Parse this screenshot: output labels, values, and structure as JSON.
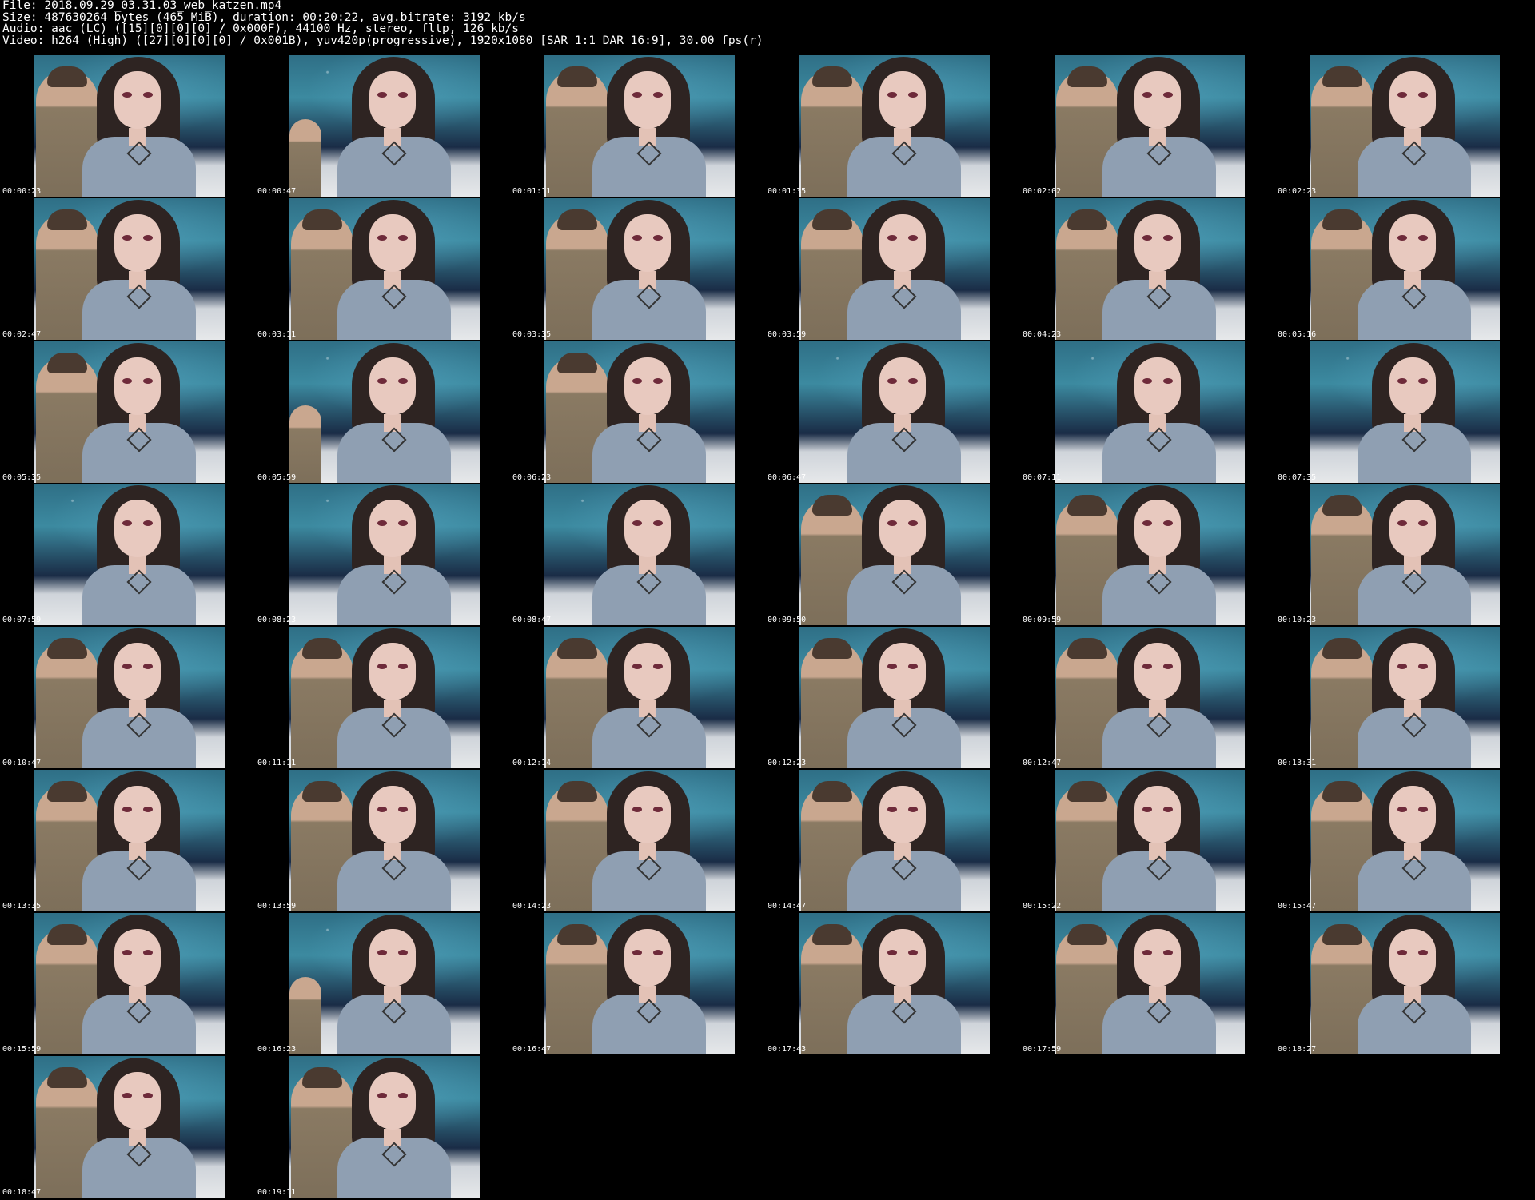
{
  "header": {
    "file": "File: 2018.09.29_03.31.03_web_katzen.mp4",
    "size": "Size: 487630264 bytes (465 MiB), duration: 00:20:22, avg.bitrate: 3192 kb/s",
    "audio": "Audio: aac (LC) ([15][0][0][0] / 0x000F), 44100 Hz, stereo, fltp, 126 kb/s",
    "video": "Video: h264 (High) ([27][0][0][0] / 0x001B), yuv420p(progressive), 1920x1080 [SAR 1:1 DAR 16:9], 30.00 fps(r)"
  },
  "thumbnails": [
    {
      "time": "00:00:23",
      "variant": "duo"
    },
    {
      "time": "00:00:47",
      "variant": "left-arm"
    },
    {
      "time": "00:01:11",
      "variant": "duo"
    },
    {
      "time": "00:01:35",
      "variant": "duo"
    },
    {
      "time": "00:02:02",
      "variant": "duo"
    },
    {
      "time": "00:02:23",
      "variant": "duo"
    },
    {
      "time": "00:02:47",
      "variant": "duo"
    },
    {
      "time": "00:03:11",
      "variant": "duo"
    },
    {
      "time": "00:03:35",
      "variant": "duo"
    },
    {
      "time": "00:03:59",
      "variant": "duo"
    },
    {
      "time": "00:04:23",
      "variant": "duo"
    },
    {
      "time": "00:05:16",
      "variant": "duo"
    },
    {
      "time": "00:05:35",
      "variant": "duo"
    },
    {
      "time": "00:05:59",
      "variant": "left-arm"
    },
    {
      "time": "00:06:23",
      "variant": "duo"
    },
    {
      "time": "00:06:47",
      "variant": "solo"
    },
    {
      "time": "00:07:11",
      "variant": "solo"
    },
    {
      "time": "00:07:35",
      "variant": "solo"
    },
    {
      "time": "00:07:59",
      "variant": "solo"
    },
    {
      "time": "00:08:23",
      "variant": "solo"
    },
    {
      "time": "00:08:47",
      "variant": "solo"
    },
    {
      "time": "00:09:50",
      "variant": "duo"
    },
    {
      "time": "00:09:59",
      "variant": "duo"
    },
    {
      "time": "00:10:23",
      "variant": "duo"
    },
    {
      "time": "00:10:47",
      "variant": "duo"
    },
    {
      "time": "00:11:11",
      "variant": "duo"
    },
    {
      "time": "00:12:14",
      "variant": "duo"
    },
    {
      "time": "00:12:23",
      "variant": "duo"
    },
    {
      "time": "00:12:47",
      "variant": "duo"
    },
    {
      "time": "00:13:31",
      "variant": "duo"
    },
    {
      "time": "00:13:35",
      "variant": "duo"
    },
    {
      "time": "00:13:59",
      "variant": "duo"
    },
    {
      "time": "00:14:23",
      "variant": "duo"
    },
    {
      "time": "00:14:47",
      "variant": "duo"
    },
    {
      "time": "00:15:22",
      "variant": "duo"
    },
    {
      "time": "00:15:47",
      "variant": "duo"
    },
    {
      "time": "00:15:59",
      "variant": "duo"
    },
    {
      "time": "00:16:23",
      "variant": "left-arm"
    },
    {
      "time": "00:16:47",
      "variant": "duo"
    },
    {
      "time": "00:17:43",
      "variant": "duo"
    },
    {
      "time": "00:17:59",
      "variant": "duo"
    },
    {
      "time": "00:18:27",
      "variant": "duo"
    },
    {
      "time": "00:18:47",
      "variant": "duo"
    },
    {
      "time": "00:19:11",
      "variant": "duo"
    }
  ]
}
